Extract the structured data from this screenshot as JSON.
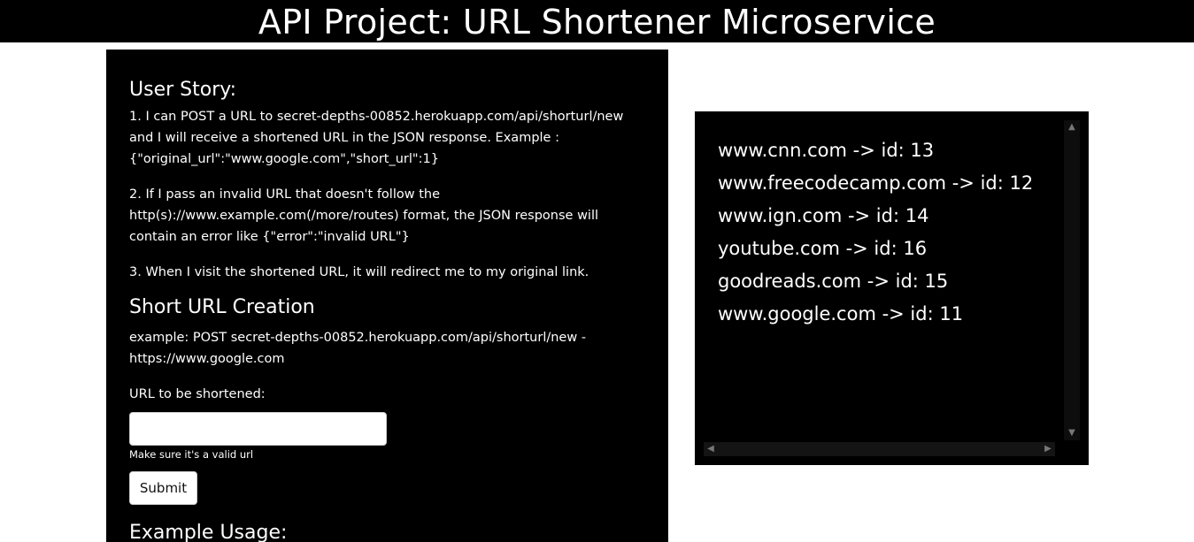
{
  "header": {
    "title": "API Project: URL Shortener Microservice"
  },
  "story": {
    "heading": "User Story:",
    "items": [
      "1. I can POST a URL to secret-depths-00852.herokuapp.com/api/shorturl/new and I will receive a shortened URL in the JSON response. Example : {\"original_url\":\"www.google.com\",\"short_url\":1}",
      "2. If I pass an invalid URL that doesn't follow the http(s)://www.example.com(/more/routes) format, the JSON response will contain an error like {\"error\":\"invalid URL\"}",
      "3. When I visit the shortened URL, it will redirect me to my original link."
    ]
  },
  "creation": {
    "heading": "Short URL Creation",
    "example": "example: POST secret-depths-00852.herokuapp.com/api/shorturl/new - https://www.google.com"
  },
  "form": {
    "label": "URL to be shortened:",
    "input_value": "",
    "placeholder": "",
    "hint": "Make sure it's a valid url",
    "submit_label": "Submit"
  },
  "usage": {
    "heading": "Example Usage:"
  },
  "url_list": [
    "www.cnn.com -> id: 13",
    "www.freecodecamp.com -> id: 12",
    "www.ign.com -> id: 14",
    "youtube.com -> id: 16",
    "goodreads.com -> id: 15",
    "www.google.com -> id: 11"
  ],
  "icons": {
    "scroll_up": "chevron-up-icon",
    "scroll_down": "chevron-down-icon",
    "scroll_left": "chevron-left-icon",
    "scroll_right": "chevron-right-icon"
  },
  "colors": {
    "panel_bg": "#000000",
    "page_bg": "#ffffff",
    "text": "#ffffff"
  }
}
